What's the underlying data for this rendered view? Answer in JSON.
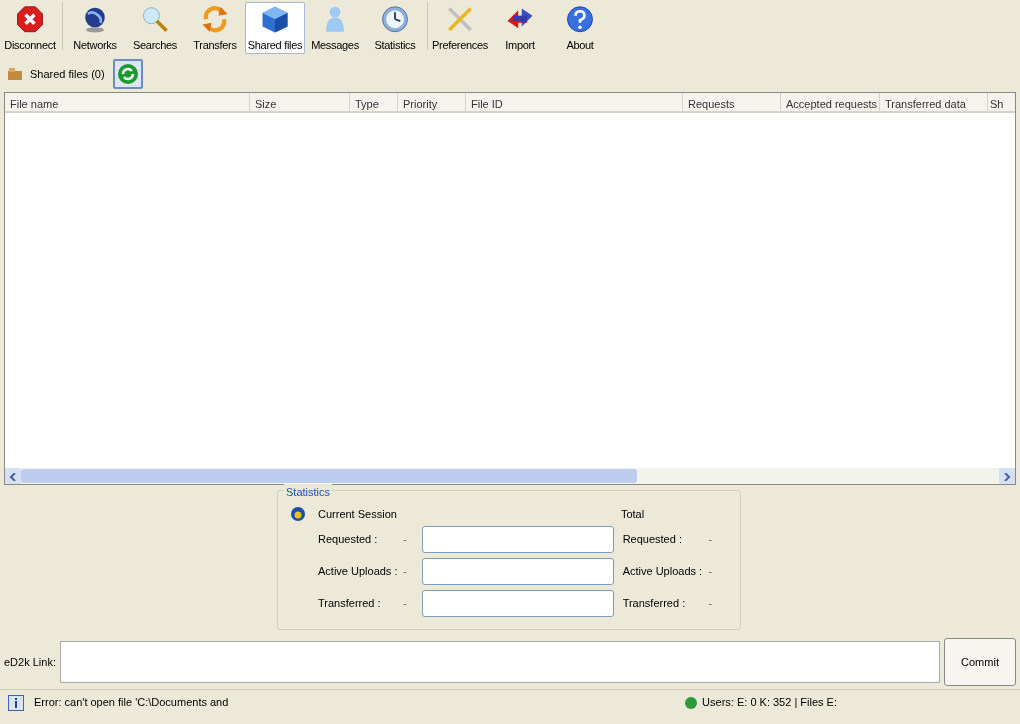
{
  "toolbar": [
    {
      "label": "Disconnect",
      "selected": false
    },
    {
      "label": "Networks",
      "selected": false
    },
    {
      "label": "Searches",
      "selected": false
    },
    {
      "label": "Transfers",
      "selected": false
    },
    {
      "label": "Shared files",
      "selected": true
    },
    {
      "label": "Messages",
      "selected": false
    },
    {
      "label": "Statistics",
      "selected": false
    },
    {
      "label": "Preferences",
      "selected": false
    },
    {
      "label": "Import",
      "selected": false
    },
    {
      "label": "About",
      "selected": false
    }
  ],
  "shared_header": {
    "label": "Shared files (0)"
  },
  "table": {
    "columns": [
      "File name",
      "Size",
      "Type",
      "Priority",
      "File ID",
      "Requests",
      "Accepted requests",
      "Transferred data",
      "Sh"
    ]
  },
  "statistics": {
    "title": "Statistics",
    "current_title": "Current Session",
    "total_title": "Total",
    "rows": [
      {
        "label": "Requested :",
        "current": "-",
        "total_label": "Requested :",
        "total": "-"
      },
      {
        "label": "Active Uploads :",
        "current": "-",
        "total_label": "Active Uploads :",
        "total": "-"
      },
      {
        "label": "Transferred :",
        "current": "-",
        "total_label": "Transferred :",
        "total": "-"
      }
    ]
  },
  "ed2k": {
    "label": "eD2k Link:",
    "button": "Commit"
  },
  "status_bar": {
    "message": "Error: can't open file 'C:\\Documents and",
    "users": "Users: E: 0 K: 352 | Files E:"
  }
}
